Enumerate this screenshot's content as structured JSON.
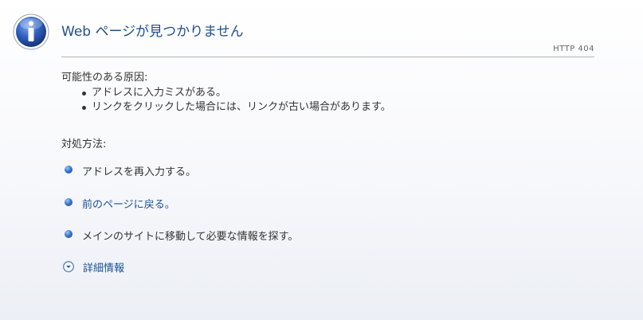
{
  "header": {
    "title": "Web ページが見つかりません",
    "status_code": "HTTP 404",
    "icon": "info-icon"
  },
  "causes": {
    "heading": "可能性のある原因:",
    "items": [
      "アドレスに入力ミスがある。",
      "リンクをクリックした場合には、リンクが古い場合があります。"
    ]
  },
  "actions": {
    "heading": "対処方法:",
    "retype": "アドレスを再入力する。",
    "back_link": "前のページに戻る。",
    "main_site": "メインのサイトに移動して必要な情報を探す。"
  },
  "more_info": {
    "label": "詳細情報",
    "icon": "chevron-down-circle-icon"
  },
  "colors": {
    "title": "#1f4f8f",
    "link": "#1a5296",
    "text": "#333333"
  }
}
